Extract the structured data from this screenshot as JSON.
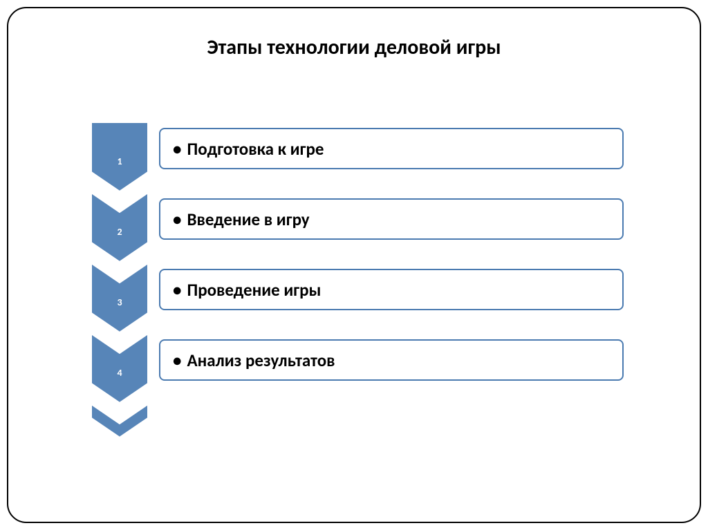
{
  "title": "Этапы технологии деловой игры",
  "colors": {
    "chevron_fill": "#5785b8",
    "chevron_stroke": "#ffffff",
    "box_border": "#4a7ab0"
  },
  "steps": [
    {
      "num": "1",
      "text": "Подготовка к игре"
    },
    {
      "num": "2",
      "text": "Введение в игру"
    },
    {
      "num": "3",
      "text": "Проведение игры"
    },
    {
      "num": "4",
      "text": "Анализ результатов"
    }
  ]
}
